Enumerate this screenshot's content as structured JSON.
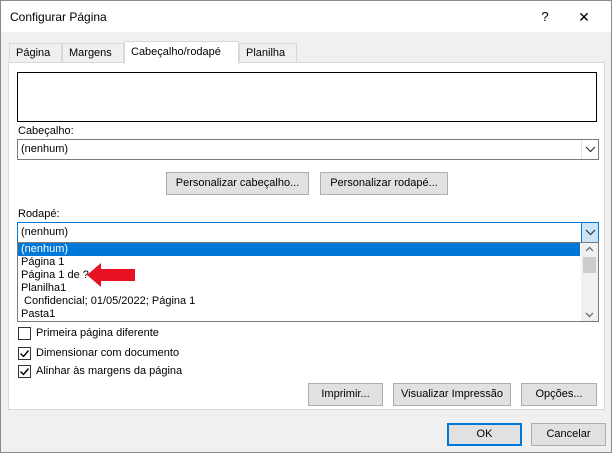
{
  "window": {
    "title": "Configurar Página",
    "help_label": "?",
    "close_label": "✕"
  },
  "tabs": [
    {
      "label": "Página"
    },
    {
      "label": "Margens"
    },
    {
      "label": "Cabeçalho/rodapé"
    },
    {
      "label": "Planilha"
    }
  ],
  "header": {
    "label": "Cabeçalho:",
    "value": "(nenhum)",
    "customize_button": "Personalizar cabeçalho...",
    "customize_footer_button": "Personalizar rodapé..."
  },
  "footer": {
    "label": "Rodapé:",
    "value": "(nenhum)",
    "options": [
      "(nenhum)",
      "Página 1",
      "Página 1 de ?",
      "Planilha1",
      " Confidencial; 01/05/2022; Página 1",
      "Pasta1"
    ],
    "selected_index": 0
  },
  "checkboxes": [
    {
      "label": "Primeira página diferente",
      "checked": false
    },
    {
      "label": "Dimensionar com documento",
      "checked": true
    },
    {
      "label": "Alinhar às margens da página",
      "checked": true
    }
  ],
  "buttons": {
    "print": "Imprimir...",
    "preview": "Visualizar Impressão",
    "options": "Opções...",
    "ok": "OK",
    "cancel": "Cancelar"
  },
  "colors": {
    "accent": "#0078d7",
    "annotation_arrow": "#e81123"
  },
  "icons": {
    "chevron": "chevron-down-icon",
    "annotation": "red-arrow-icon"
  }
}
